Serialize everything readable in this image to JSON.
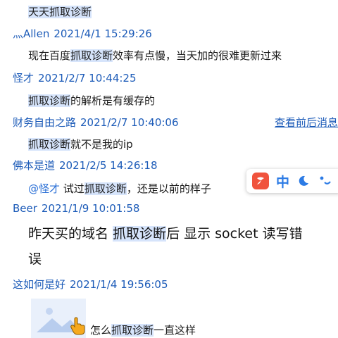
{
  "messages": [
    {
      "text_hl": "天天抓取诊断",
      "text_rest": ""
    },
    {
      "sender": "灬Allen",
      "time": "2021/4/1 15:29:26",
      "text_pre": "现在百度",
      "text_hl": "抓取诊断",
      "text_rest": "效率有点慢，当天加的很难更新过来"
    },
    {
      "sender": "怪才",
      "time": "2021/2/7 10:44:25",
      "text_hl": "抓取诊断",
      "text_rest": "的解析是有缓存的"
    },
    {
      "sender": "财务自由之路",
      "time": "2021/2/7 10:40:06",
      "text_hl": "抓取诊断",
      "text_rest": "就不是我的ip"
    },
    {
      "sender": "佛本是道",
      "time": "2021/2/5 14:26:18",
      "mention": "@怪才",
      "text_pre": " 试过",
      "text_hl": "抓取诊断",
      "text_rest": "，还是以前的样子"
    },
    {
      "sender": "Beer",
      "time": "2021/1/9 10:01:58",
      "text_line1_pre": "昨天买的域名 ",
      "text_hl": "抓取诊断",
      "text_line1_rest": "后 显示 socket 读写错",
      "text_line2": "误"
    },
    {
      "sender": "这如何是好",
      "time": "2021/1/4 19:56:05",
      "text_pre": "怎么",
      "text_hl": "抓取诊断",
      "text_rest": "一直这样"
    }
  ],
  "history_link": "查看前后消息",
  "ime": {
    "lang": "中"
  },
  "colors": {
    "link": "#1c5bb8",
    "highlight": "#d6e4fb",
    "ime_logo": "#f0533d",
    "ime_blue": "#2c7be5"
  },
  "icons": {
    "ime_logo": "sogou-logo-icon",
    "moon": "moon-icon",
    "punct": "punctuation-icon",
    "image": "image-placeholder-icon",
    "cursor": "hand-cursor-icon"
  }
}
